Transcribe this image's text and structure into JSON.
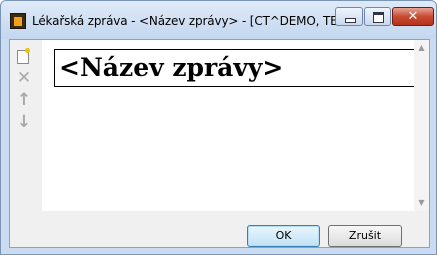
{
  "window": {
    "title": "Lékařská zpráva - <Název zprávy> - [CT^DEMO, TEST ...",
    "close_glyph": "✕"
  },
  "toolbar": {
    "delete_glyph": "✕",
    "up_glyph": "↑",
    "down_glyph": "↓"
  },
  "editor": {
    "title_value": "<Název zprávy>"
  },
  "scrollbar": {
    "up_glyph": "▲",
    "down_glyph": "▼"
  },
  "buttons": {
    "ok_label": "OK",
    "cancel_label": "Zrušit"
  },
  "colors": {
    "title_bar": "#c3d7ef",
    "close_button": "#c84a32",
    "default_button_border": "#3c7fb1"
  },
  "icons": {
    "app": "app-icon",
    "new": "new-document-icon",
    "delete": "delete-icon",
    "move_up": "arrow-up-icon",
    "move_down": "arrow-down-icon"
  }
}
